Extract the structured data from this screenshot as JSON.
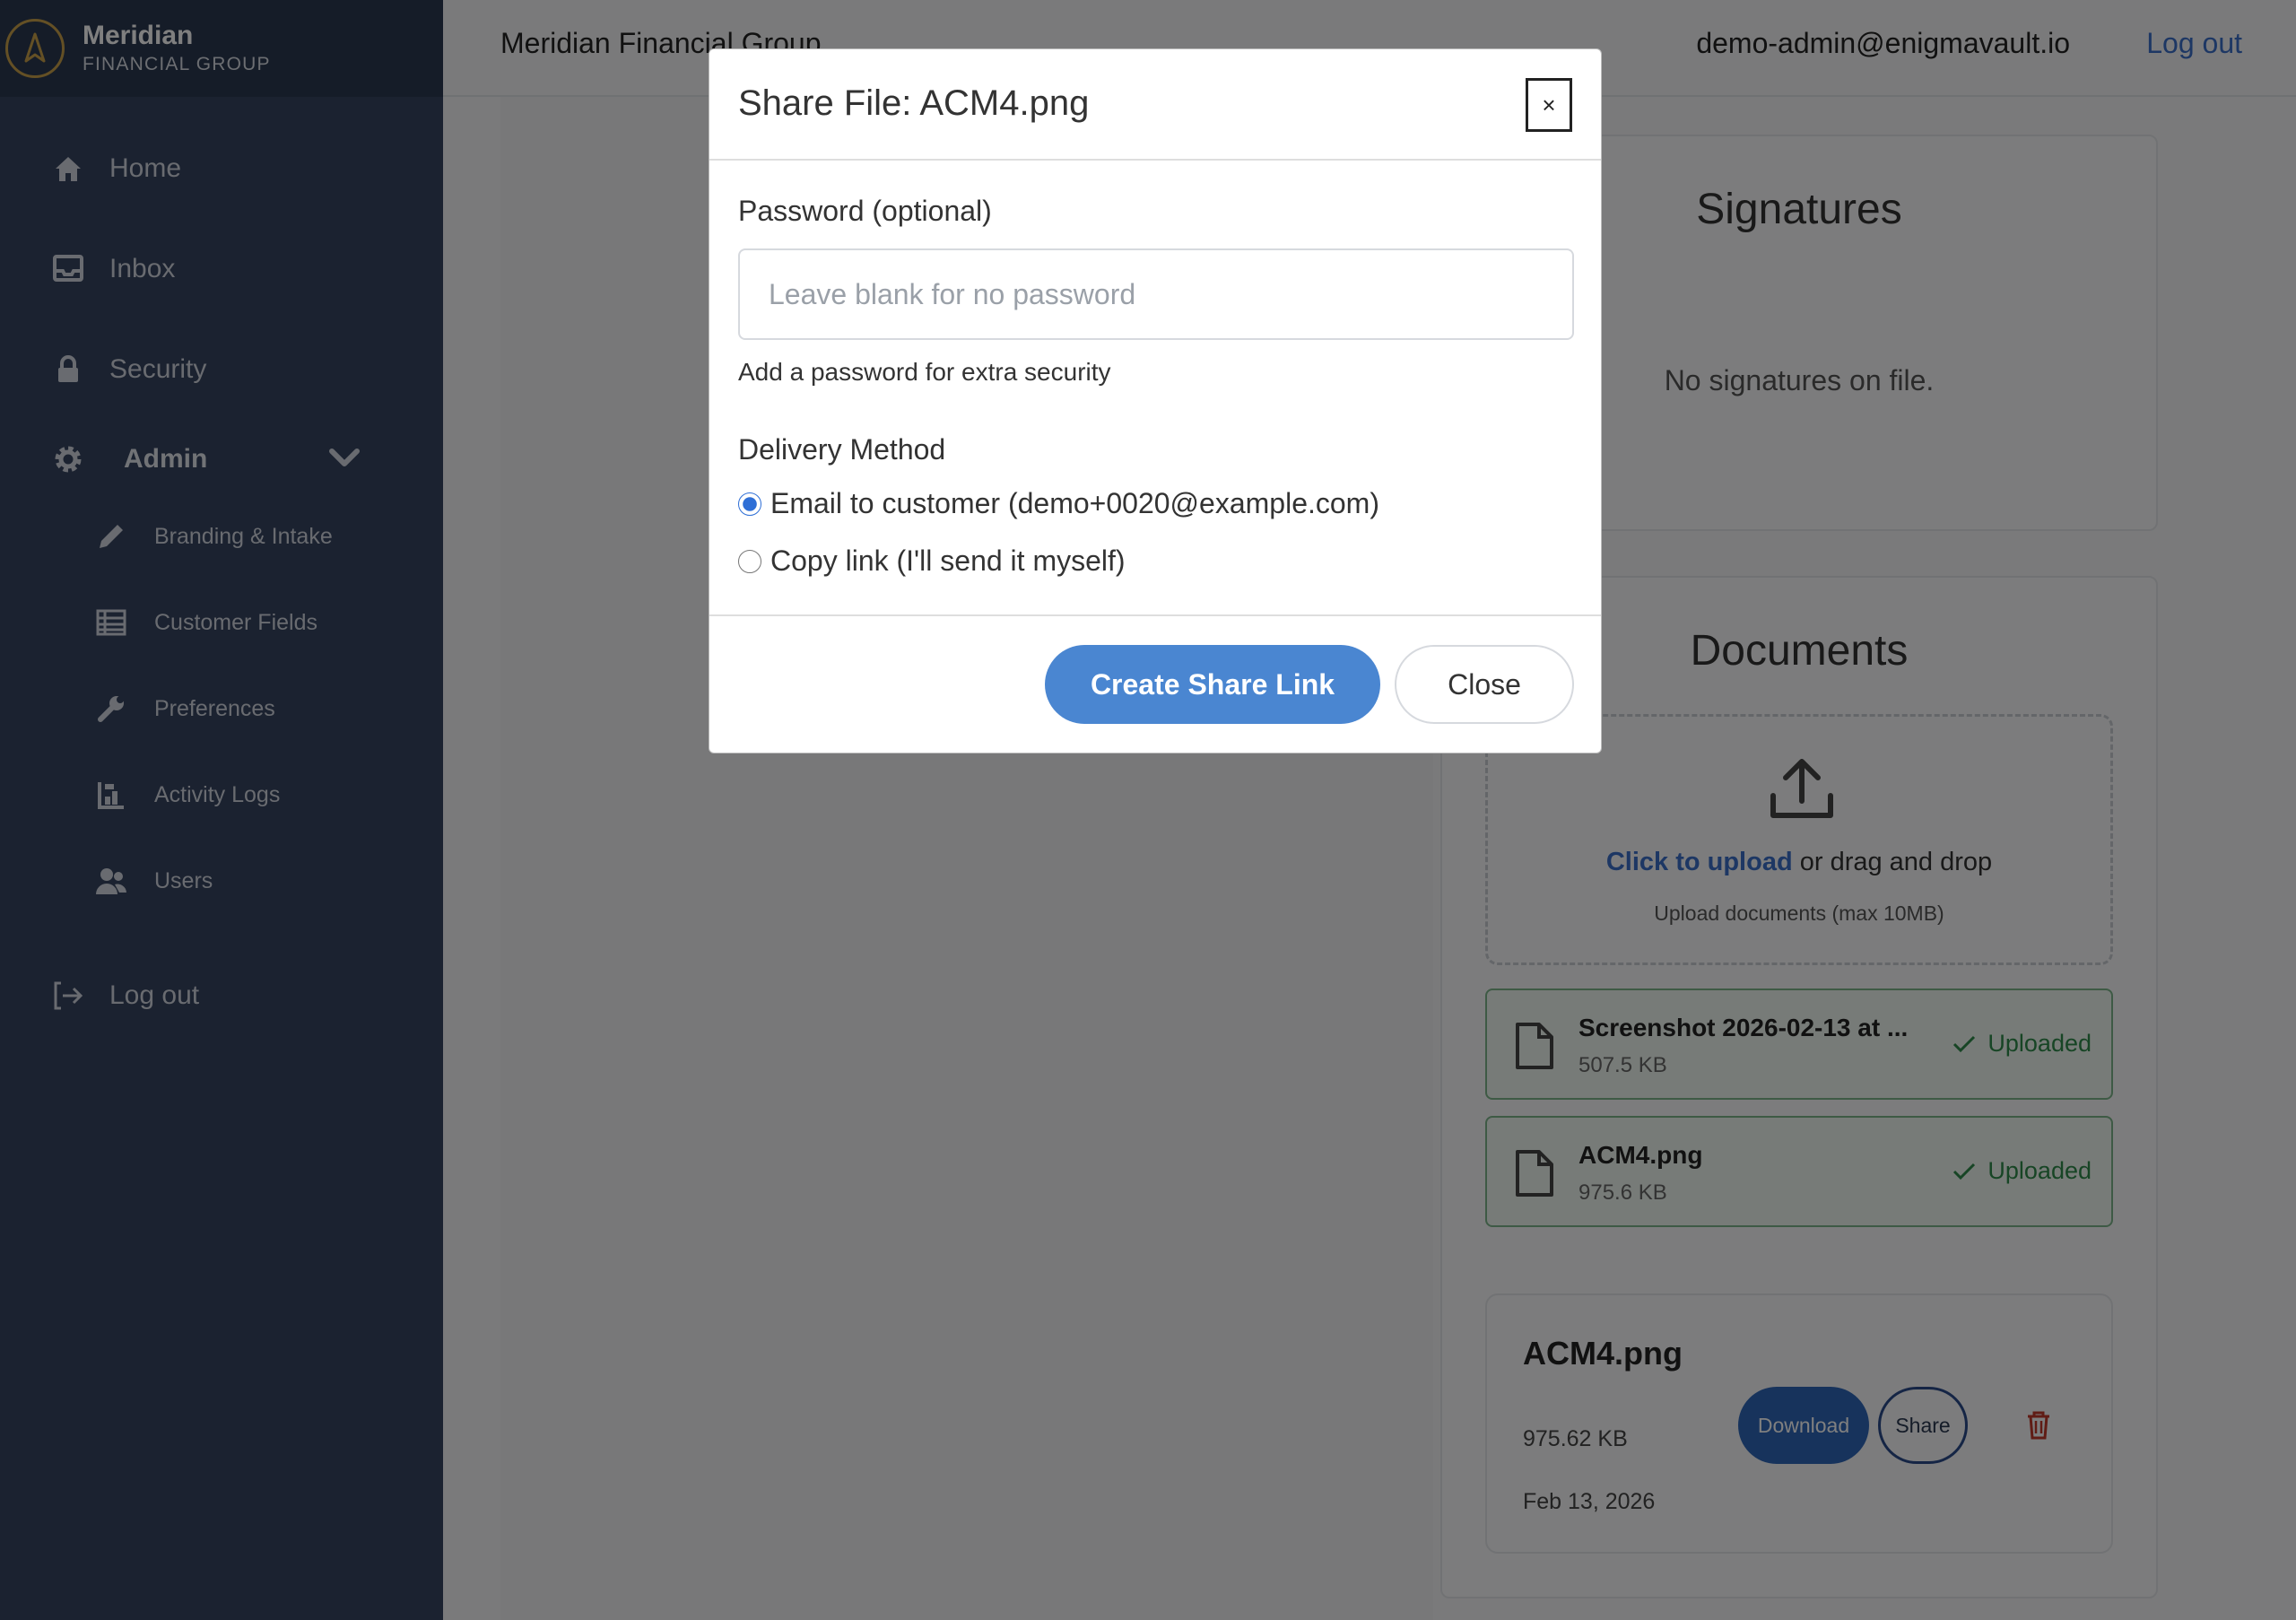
{
  "brand": {
    "name": "Meridian",
    "subtitle": "FINANCIAL GROUP"
  },
  "sidebar": {
    "items": [
      {
        "label": "Home",
        "icon": "home-icon"
      },
      {
        "label": "Inbox",
        "icon": "inbox-icon"
      },
      {
        "label": "Security",
        "icon": "lock-icon"
      },
      {
        "label": "Admin",
        "icon": "gear-icon"
      },
      {
        "label": "Branding & Intake",
        "icon": "pencil-icon"
      },
      {
        "label": "Customer Fields",
        "icon": "table-icon"
      },
      {
        "label": "Preferences",
        "icon": "wrench-icon"
      },
      {
        "label": "Activity Logs",
        "icon": "logs-icon"
      },
      {
        "label": "Users",
        "icon": "users-icon"
      },
      {
        "label": "Log out",
        "icon": "logout-icon"
      }
    ]
  },
  "topbar": {
    "org_name": "Meridian Financial Group",
    "user_email": "demo-admin@enigmavault.io",
    "logout_label": "Log out"
  },
  "signatures": {
    "title": "Signatures",
    "empty_text": "No signatures on file."
  },
  "documents": {
    "title": "Documents",
    "upload_link": "Click to upload",
    "upload_rest": " or drag and drop",
    "upload_hint": "Upload documents (max 10MB)",
    "uploads": [
      {
        "name": "Screenshot 2026-02-13 at ...",
        "size": "507.5 KB",
        "status": "Uploaded"
      },
      {
        "name": "ACM4.png",
        "size": "975.6 KB",
        "status": "Uploaded"
      }
    ],
    "file_card": {
      "name": "ACM4.png",
      "size": "975.62 KB",
      "date": "Feb 13, 2026",
      "download_label": "Download",
      "share_label": "Share"
    }
  },
  "modal": {
    "title": "Share File: ACM4.png",
    "close_x": "×",
    "password_label": "Password (optional)",
    "password_value": "",
    "password_placeholder": "Leave blank for no password",
    "password_help": "Add a password for extra security",
    "delivery_label": "Delivery Method",
    "delivery_options": [
      {
        "label": "Email to customer (demo+0020@example.com)",
        "selected": true
      },
      {
        "label": "Copy link (I'll send it myself)",
        "selected": false
      }
    ],
    "create_label": "Create Share Link",
    "close_label": "Close"
  },
  "colors": {
    "sidebar_bg": "#374560",
    "accent": "#4a86d1",
    "brand_gold": "#c9a14a",
    "success": "#2f8a4a",
    "danger": "#c0392b"
  }
}
